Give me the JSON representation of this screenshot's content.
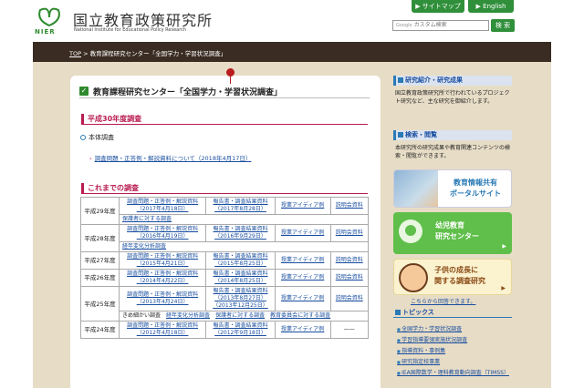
{
  "header": {
    "org_name_jp": "国立教育政策研究所",
    "org_name_en": "National Institute for Educational Policy Research",
    "logo_text": "NIER",
    "sitemap_label": "サイトマップ",
    "english_label": "English",
    "search_prefix": "Google",
    "search_placeholder": "カスタム検索",
    "search_button": "検 索"
  },
  "breadcrumb": {
    "top": "TOP",
    "rest": " > 教育課程研究センター「全国学力・学習状況調査」"
  },
  "main": {
    "title": "教育課程研究センター「全国学力・学習状況調査」",
    "section1": "平成30年度調査",
    "sub1": "本体調査",
    "link1": "調査問題・正答例・解説資料について（2018年4月17日）",
    "section2": "これまでの調査"
  },
  "history_rows": [
    {
      "year": "平成29年度",
      "c1": "調査問題・正答例・解説資料",
      "d1": "（2017年4月18日）",
      "c2": "報告書・調査結果資料",
      "d2": "（2017年8月28日）",
      "c3": "授業アイディア例",
      "c4": "説明会資料",
      "extra": "保護者に対する調査"
    },
    {
      "year": "平成28年度",
      "c1": "調査問題・正答例・解説資料",
      "d1": "（2016年4月19日）",
      "c2": "報告書・調査結果資料",
      "d2": "（2016年9月29日）",
      "c3": "授業アイディア例",
      "c4": "説明会資料",
      "extra": "経年変化分析調査"
    },
    {
      "year": "平成27年度",
      "c1": "調査問題・正答例・解説資料",
      "d1": "（2015年4月21日）",
      "c2": "報告書・調査結果資料",
      "d2": "（2015年8月25日）",
      "c3": "授業アイディア例",
      "c4": "説明会資料"
    },
    {
      "year": "平成26年度",
      "c1": "調査問題・正答例・解説資料",
      "d1": "（2014年4月22日）",
      "c2": "報告書・調査結果資料",
      "d2": "（2014年8月25日）",
      "c3": "授業アイディア例",
      "c4": "説明会資料"
    },
    {
      "year": "平成25年度",
      "c1": "調査問題・正答例・解説資料",
      "d1": "（2013年4月24日）",
      "c2": "報告書・調査結果資料",
      "d2": "（2013年8月27日）",
      "d2b": "（2013年12月25日）",
      "c3": "授業アイディア例",
      "c4": "説明会資料",
      "extra_label": "きめ細かい調査",
      "extra_a": "経年変化分析調査",
      "extra_b": "保護者に対する調査",
      "extra_c": "教育委員会に対する調査"
    },
    {
      "year": "平成24年度",
      "c1": "調査問題・正答例・解説資料",
      "d1": "（2012年4月18日）",
      "c2": "報告書・調査結果資料",
      "d2": "（2012年9月18日）",
      "c3": "授業アイディア例",
      "c4": "——"
    }
  ],
  "sidebar": {
    "h1": "研究紹介・研究成果",
    "t1": "国立教育政策研究所で行われているプロジェクト研究など、主な研究を御紹介します。",
    "h2": "検索・閲覧",
    "t2": "本研究所の研究成果や教育関連コンテンツの検索・閲覧ができます。",
    "banner1": "教育情報共有\nポータルサイト",
    "banner2": "幼児教育\n研究センター",
    "banner3": "子供の成長に\n関する調査研究",
    "notice": "こちらから回答できます。",
    "topics_title": "トピックス",
    "topics": [
      "全国学力・学習状況調査",
      "学習指導要領実施状況調査",
      "指導資料・事例集",
      "研究指定校事業",
      "IEA国際数学・理科教育動向調査（TIMSS）"
    ]
  },
  "colors": {
    "accent": "#2f8f3a",
    "section": "#b81c50",
    "link": "#1a4fa0",
    "bg": "#e7dcc6",
    "bar": "#3a2c22"
  }
}
